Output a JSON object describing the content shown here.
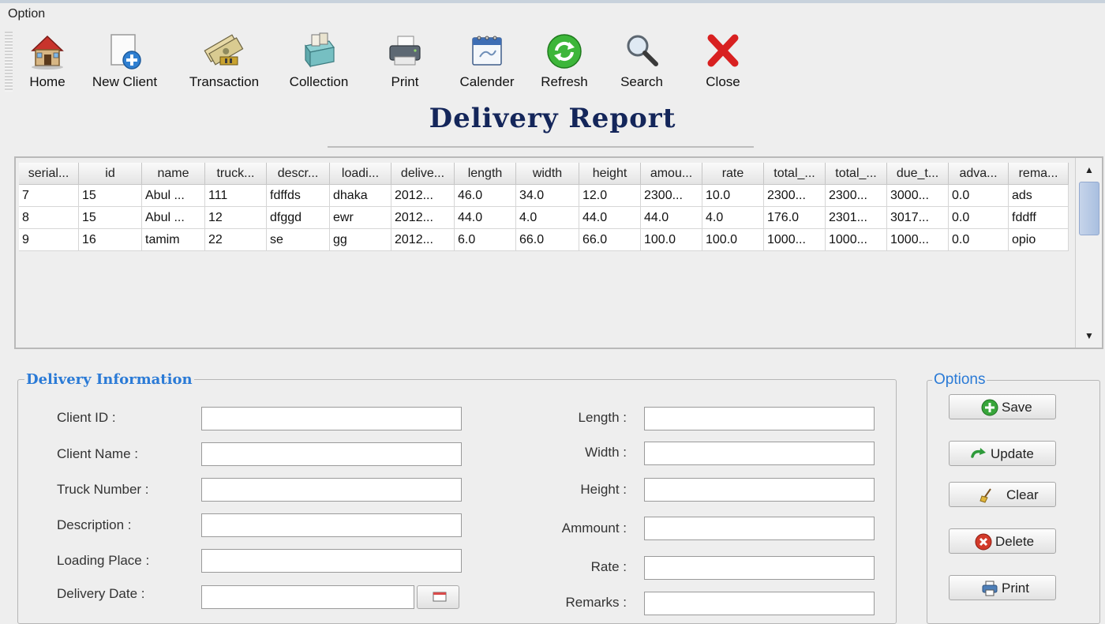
{
  "menu": {
    "option": "Option"
  },
  "toolbar": {
    "home": "Home",
    "new_client": "New Client",
    "transaction": "Transaction",
    "collection": "Collection",
    "print": "Print",
    "calender": "Calender",
    "refresh": "Refresh",
    "search": "Search",
    "close": "Close"
  },
  "title": "Delivery Report",
  "table": {
    "columns": [
      "serial...",
      "id",
      "name",
      "truck...",
      "descr...",
      "loadi...",
      "delive...",
      "length",
      "width",
      "height",
      "amou...",
      "rate",
      "total_...",
      "total_...",
      "due_t...",
      "adva...",
      "rema..."
    ],
    "rows": [
      [
        "7",
        "15",
        "Abul ...",
        "111",
        "fdffds",
        "dhaka",
        "2012...",
        "46.0",
        "34.0",
        "12.0",
        "2300...",
        "10.0",
        "2300...",
        "2300...",
        "3000...",
        "0.0",
        "ads"
      ],
      [
        "8",
        "15",
        "Abul ...",
        "12",
        "dfggd",
        "ewr",
        "2012...",
        "44.0",
        "4.0",
        "44.0",
        "44.0",
        "4.0",
        "176.0",
        "2301...",
        "3017...",
        "0.0",
        "fddff"
      ],
      [
        "9",
        "16",
        "tamim",
        "22",
        "se",
        "gg",
        "2012...",
        "6.0",
        "66.0",
        "66.0",
        "100.0",
        "100.0",
        "1000...",
        "1000...",
        "1000...",
        "0.0",
        "opio"
      ]
    ]
  },
  "delivery_info": {
    "legend": "Delivery Information",
    "client_id": "Client ID :",
    "client_name": "Client Name :",
    "truck_number": "Truck Number :",
    "description": "Description :",
    "loading_place": "Loading Place :",
    "delivery_date": "Delivery Date :",
    "length": "Length :",
    "width": "Width :",
    "height": "Height :",
    "ammount": "Ammount :",
    "rate": "Rate :",
    "remarks": "Remarks :"
  },
  "options": {
    "legend": "Options",
    "save": "Save",
    "update": "Update",
    "clear": "Clear",
    "delete": "Delete",
    "print": "Print"
  },
  "colors": {
    "title": "#14265a",
    "legend": "#2a7ad6",
    "background": "#eeeeee"
  }
}
